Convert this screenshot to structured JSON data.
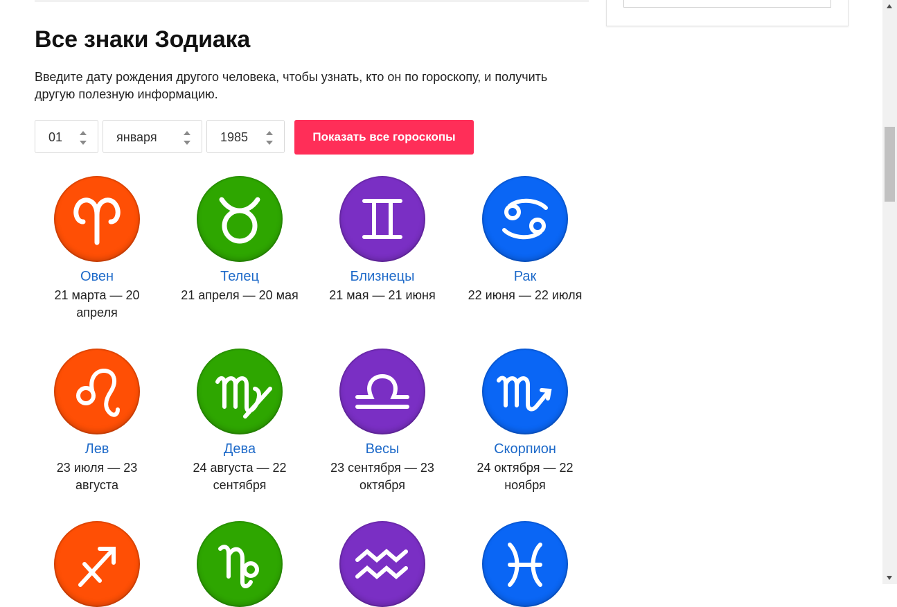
{
  "page": {
    "title": "Все знаки Зодиака",
    "intro": "Введите дату рождения другого человека, чтобы узнать, кто он по гороскопу, и получить другую полезную информацию."
  },
  "form": {
    "day": "01",
    "month": "января",
    "year": "1985",
    "submit_label": "Показать все гороскопы"
  },
  "colors": {
    "fire": "#ff4f05",
    "earth": "#2ea600",
    "air": "#7a2fc4",
    "water": "#0a66f5",
    "button": "#ff2e58",
    "link": "#1e6ac9"
  },
  "signs": [
    {
      "name": "Овен",
      "dates": "21 марта — 20 апреля",
      "icon": "aries-icon"
    },
    {
      "name": "Телец",
      "dates": "21 апреля — 20 мая",
      "icon": "taurus-icon"
    },
    {
      "name": "Близнецы",
      "dates": "21 мая — 21 июня",
      "icon": "gemini-icon"
    },
    {
      "name": "Рак",
      "dates": "22 июня — 22 июля",
      "icon": "cancer-icon"
    },
    {
      "name": "Лев",
      "dates": "23 июля — 23 августа",
      "icon": "leo-icon"
    },
    {
      "name": "Дева",
      "dates": "24 августа — 22 сентября",
      "icon": "virgo-icon"
    },
    {
      "name": "Весы",
      "dates": "23 сентября — 23 октября",
      "icon": "libra-icon"
    },
    {
      "name": "Скорпион",
      "dates": "24 октября — 22 ноября",
      "icon": "scorpio-icon"
    },
    {
      "icon": "sagittarius-icon"
    },
    {
      "icon": "capricorn-icon"
    },
    {
      "icon": "aquarius-icon"
    },
    {
      "icon": "pisces-icon"
    }
  ]
}
